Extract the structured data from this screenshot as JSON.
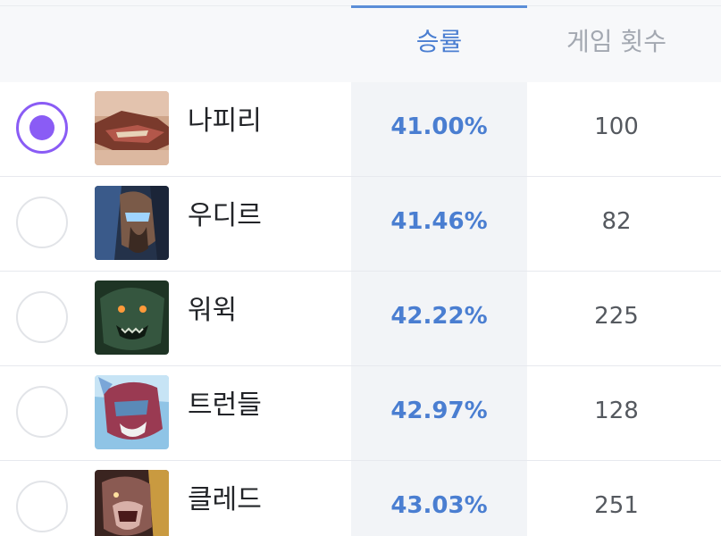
{
  "header": {
    "winrate_label": "승률",
    "games_label": "게임 횟수"
  },
  "colors": {
    "accent_blue": "#4a7ed1",
    "radio_purple": "#8a5cf5"
  },
  "rows": [
    {
      "name": "나피리",
      "winrate": "41.00%",
      "games": "100",
      "selected": true,
      "portrait_icon": "naafiri-portrait"
    },
    {
      "name": "우디르",
      "winrate": "41.46%",
      "games": "82",
      "selected": false,
      "portrait_icon": "udyr-portrait"
    },
    {
      "name": "워윅",
      "winrate": "42.22%",
      "games": "225",
      "selected": false,
      "portrait_icon": "warwick-portrait"
    },
    {
      "name": "트런들",
      "winrate": "42.97%",
      "games": "128",
      "selected": false,
      "portrait_icon": "trundle-portrait"
    },
    {
      "name": "클레드",
      "winrate": "43.03%",
      "games": "251",
      "selected": false,
      "portrait_icon": "kled-portrait"
    }
  ]
}
